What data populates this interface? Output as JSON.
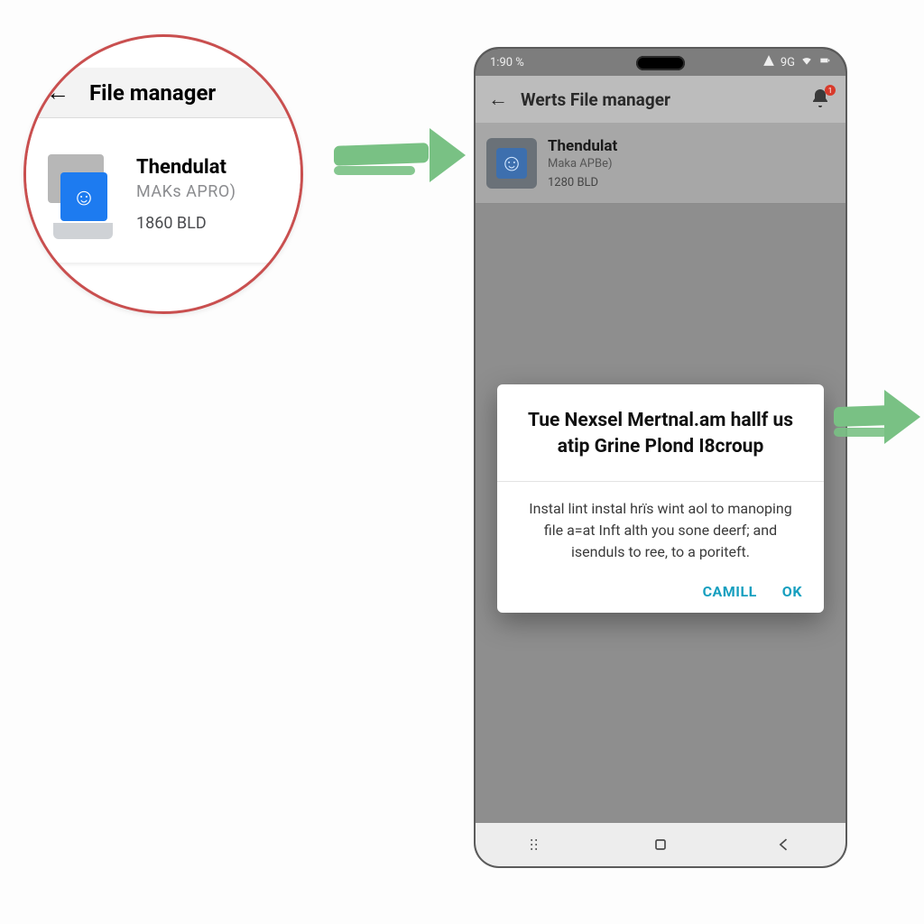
{
  "callout": {
    "header_title": "File manager",
    "app": {
      "name": "Thendulat",
      "subtitle": "MAKs APRO)",
      "size": "1860 BLD",
      "icon": "file-app-icon"
    }
  },
  "phone": {
    "status": {
      "time": "1:90 %",
      "net_label": "9G"
    },
    "topbar": {
      "title": "Werts File manager",
      "notification_count": "1"
    },
    "list_item": {
      "name": "Thendulat",
      "subtitle": "Maka APBe)",
      "size": "1280 BLD",
      "icon": "file-app-icon"
    },
    "dialog": {
      "title": "Tue Nexsel Mertnal.am hallf us atip Grine Plond I8croup",
      "body": "Instal lint instal hrïs wint aol to manoping file a=at Inft alth you sone deerf; and isenduls to ree, to a poriteft.",
      "cancel_label": "CAMILL",
      "ok_label": "OK"
    }
  },
  "arrows": {
    "a1": "arrow-right",
    "a2": "arrow-right"
  }
}
